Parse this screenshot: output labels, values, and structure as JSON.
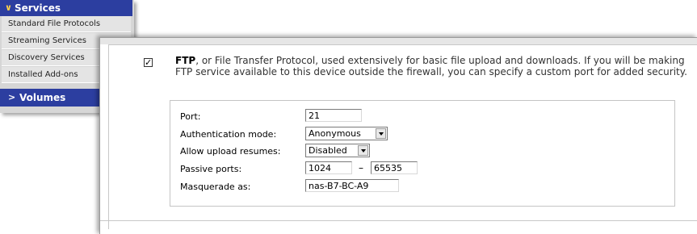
{
  "nav": {
    "header": "Services",
    "items": [
      {
        "label": "Standard File Protocols"
      },
      {
        "label": "Streaming Services"
      },
      {
        "label": "Discovery Services"
      },
      {
        "label": "Installed Add-ons"
      }
    ],
    "volumes": "Volumes",
    "header_chevron": "∨",
    "volumes_chevron": ">"
  },
  "ftp": {
    "checked": true,
    "checkmark": "✓",
    "title": "FTP",
    "description": ", or File Transfer Protocol, used extensively for basic file upload and downloads. If you will be making FTP service available to this device outside the firewall, you can specify a custom port for added security.",
    "fields": {
      "port_label": "Port:",
      "port_value": "21",
      "auth_label": "Authentication mode:",
      "auth_value": "Anonymous",
      "resume_label": "Allow upload resumes:",
      "resume_value": "Disabled",
      "passive_label": "Passive ports:",
      "passive_from": "1024",
      "passive_separator": "–",
      "passive_to": "65535",
      "masquerade_label": "Masquerade as:",
      "masquerade_value": "nas-B7-BC-A9"
    }
  },
  "colors": {
    "nav_header_bg": "#2c3ea0",
    "nav_item_bg": "#e4e4e4",
    "border": "#c4c4c4"
  }
}
